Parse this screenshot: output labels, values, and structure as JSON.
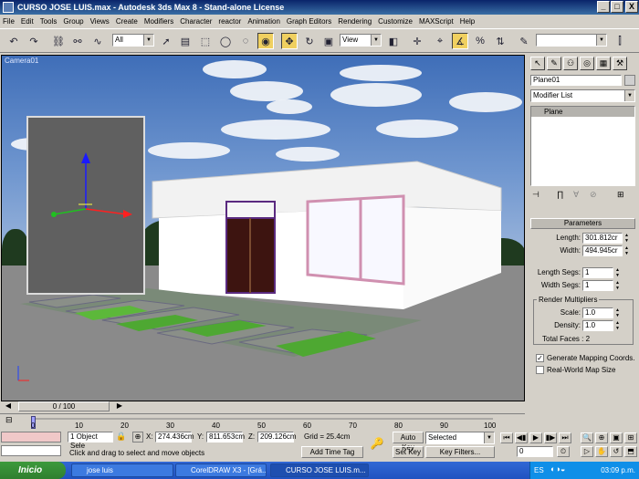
{
  "window": {
    "title": "CURSO JOSE LUIS.max - Autodesk 3ds Max 8  - Stand-alone License",
    "minimize": "_",
    "maximize": "□",
    "close": "X"
  },
  "menu": [
    "File",
    "Edit",
    "Tools",
    "Group",
    "Views",
    "Create",
    "Modifiers",
    "Character",
    "reactor",
    "Animation",
    "Graph Editors",
    "Rendering",
    "Customize",
    "MAXScript",
    "Help"
  ],
  "toolbar": {
    "selection_filter": "All",
    "reference_coord": "View",
    "named_selection": ""
  },
  "viewport": {
    "label": "Camera01"
  },
  "command_panel": {
    "object_name": "Plane01",
    "modifier_list": "Modifier List",
    "stack_item": "Plane",
    "parameters_title": "Parameters",
    "length_label": "Length:",
    "length_value": "301.812cr",
    "width_label": "Width:",
    "width_value": "494.945cr",
    "length_segs_label": "Length Segs:",
    "length_segs_value": "1",
    "width_segs_label": "Width Segs:",
    "width_segs_value": "1",
    "render_multipliers_label": "Render Multipliers",
    "scale_label": "Scale:",
    "scale_value": "1.0",
    "density_label": "Density:",
    "density_value": "1.0",
    "total_faces": "Total Faces : 2",
    "gen_mapping_label": "Generate Mapping Coords.",
    "gen_mapping_checked": true,
    "real_world_label": "Real-World Map Size",
    "real_world_checked": false
  },
  "timeline": {
    "slider": "0 / 100",
    "ticks": [
      "0",
      "10",
      "20",
      "30",
      "40",
      "50",
      "60",
      "70",
      "80",
      "90",
      "100"
    ]
  },
  "status": {
    "selection": "1 Object Sele",
    "x_label": "X:",
    "x_value": "274.436cm",
    "y_label": "Y:",
    "y_value": "811.653cm",
    "z_label": "Z:",
    "z_value": "209.126cm",
    "grid": "Grid = 25.4cm",
    "prompt": "Click and drag to select and move objects",
    "add_time_tag": "Add Time Tag",
    "auto_key": "Auto Key",
    "set_key": "Set Key",
    "key_mode": "Selected",
    "key_filters": "Key Filters...",
    "frame": "0"
  },
  "taskbar": {
    "start": "Inicio",
    "items": [
      "jose luis",
      "CorelDRAW X3 - [Grá...",
      "CURSO JOSE LUIS.m..."
    ],
    "lang": "ES",
    "clock": "03:09 p.m."
  },
  "colors": {
    "titlebar": "#0a246a",
    "active_tool": "#f0d060",
    "sky": "#4a78c0",
    "grass": "#4ea832"
  }
}
